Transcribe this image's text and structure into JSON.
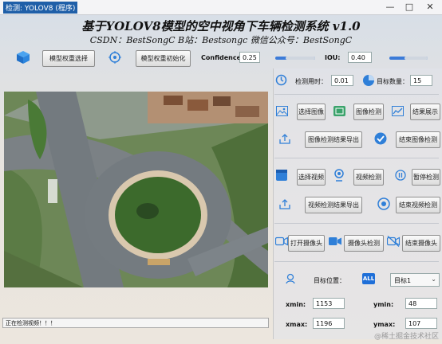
{
  "window": {
    "title": "检测: YOLOV8 (程序)"
  },
  "header": {
    "title": "基于YOLOV8模型的空中视角下车辆检测系统 v1.0",
    "subtitle": "CSDN：BestSongC   B站：Bestsongc   微信公众号：BestSongC"
  },
  "toolbar": {
    "select_weights": "模型权重选择",
    "init_weights": "模型权重初始化",
    "confidence_label": "Confidence:",
    "confidence_value": "0.25",
    "iou_label": "IOU:",
    "iou_value": "0.40",
    "confidence_level": 0.25,
    "iou_level": 0.4
  },
  "stats": {
    "time_label": "检测用时：",
    "time_value": "0.01",
    "count_label": "目标数量：",
    "count_value": "15"
  },
  "image_controls": {
    "select_image": "选择图像",
    "detect_image": "图像检测",
    "show_results": "结果展示",
    "export_image": "图像检测结果导出",
    "stop_image": "结束图像检测"
  },
  "video_controls": {
    "select_video": "选择视频",
    "detect_video": "视频检测",
    "pause": "暂停检测",
    "export_video": "视频检测结果导出",
    "stop_video": "结束视频检测"
  },
  "camera_controls": {
    "open_camera": "打开摄像头",
    "detect_camera": "摄像头检测",
    "stop_camera": "结束摄像头"
  },
  "target": {
    "position_label": "目标位置：",
    "all_badge": "ALL",
    "selected_target": "目标1",
    "xmin_label": "xmin:",
    "xmin_value": "1153",
    "ymin_label": "ymin:",
    "ymin_value": "48",
    "xmax_label": "xmax:",
    "xmax_value": "1196",
    "ymax_label": "ymax:",
    "ymax_value": "107"
  },
  "status": {
    "text": "正在检测视频！！！"
  },
  "watermark": "@稀土掘金技术社区",
  "colors": {
    "accent": "#2f7fd8",
    "slider": "#3b7bd8"
  }
}
